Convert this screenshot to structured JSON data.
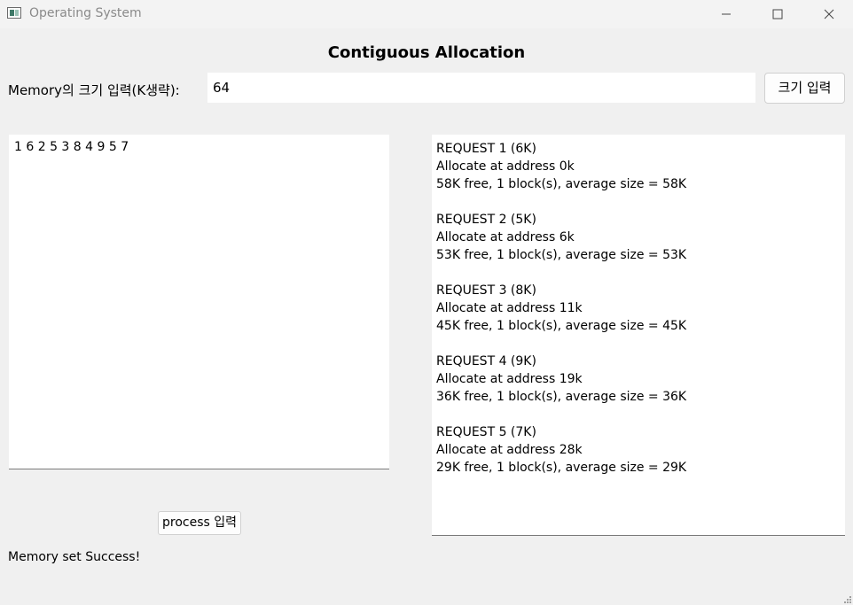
{
  "window": {
    "title": "Operating System",
    "minimize_icon": "minimize-icon",
    "maximize_icon": "maximize-icon",
    "close_icon": "close-icon"
  },
  "heading": "Contiguous Allocation",
  "memory": {
    "label": "Memory의 크기 입력(K생략):",
    "value": "64",
    "button_label": "크기 입력"
  },
  "process": {
    "input_value": "1 6 2 5 3 8 4 9 5 7",
    "button_label": "process 입력"
  },
  "log": [
    {
      "request": "REQUEST 1 (6K)",
      "allocate": "Allocate at address 0k",
      "summary": "58K free, 1 block(s), average size = 58K"
    },
    {
      "request": "REQUEST 2 (5K)",
      "allocate": "Allocate at address 6k",
      "summary": "53K free, 1 block(s), average size = 53K"
    },
    {
      "request": "REQUEST 3 (8K)",
      "allocate": "Allocate at address 11k",
      "summary": "45K free, 1 block(s), average size = 45K"
    },
    {
      "request": "REQUEST 4 (9K)",
      "allocate": "Allocate at address 19k",
      "summary": "36K free, 1 block(s), average size = 36K"
    },
    {
      "request": "REQUEST 5 (7K)",
      "allocate": "Allocate at address 28k",
      "summary": "29K free, 1 block(s), average size = 29K"
    }
  ],
  "status": "Memory set Success!",
  "colors": {
    "window_bg": "#f0f0f0",
    "field_bg": "#ffffff",
    "title_text": "#8a8a8a",
    "icon_accent": "#3f7a68"
  }
}
